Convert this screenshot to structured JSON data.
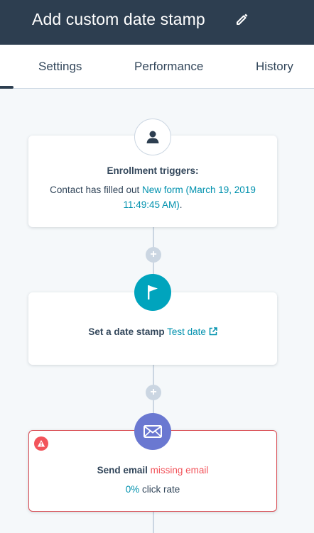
{
  "header": {
    "title": "Add custom date stamp",
    "edit_icon": "pencil-icon"
  },
  "tabs": [
    {
      "label": "Settings"
    },
    {
      "label": "Performance"
    },
    {
      "label": "History"
    }
  ],
  "workflow": {
    "trigger": {
      "icon": "contact-icon",
      "title": "Enrollment triggers:",
      "text": "Contact has filled out",
      "link_line1": "New form (March 19, 2019",
      "link_line2": "11:49:45 AM)",
      "suffix": "."
    },
    "add_action_icon": "plus-icon",
    "date_stamp": {
      "icon": "flag-icon",
      "prefix": "Set a date stamp",
      "property": "Test date",
      "external_icon": "external-link-icon"
    },
    "send_email": {
      "icon": "envelope-icon",
      "alert_icon": "warning-icon",
      "prefix": "Send email",
      "status": "missing email",
      "rate_value": "0%",
      "rate_label": "click rate"
    }
  },
  "colors": {
    "header_bg": "#2d3e50",
    "accent_teal": "#00a4bd",
    "link": "#0091ae",
    "email_purple": "#6a78d1",
    "error": "#f2545b"
  }
}
